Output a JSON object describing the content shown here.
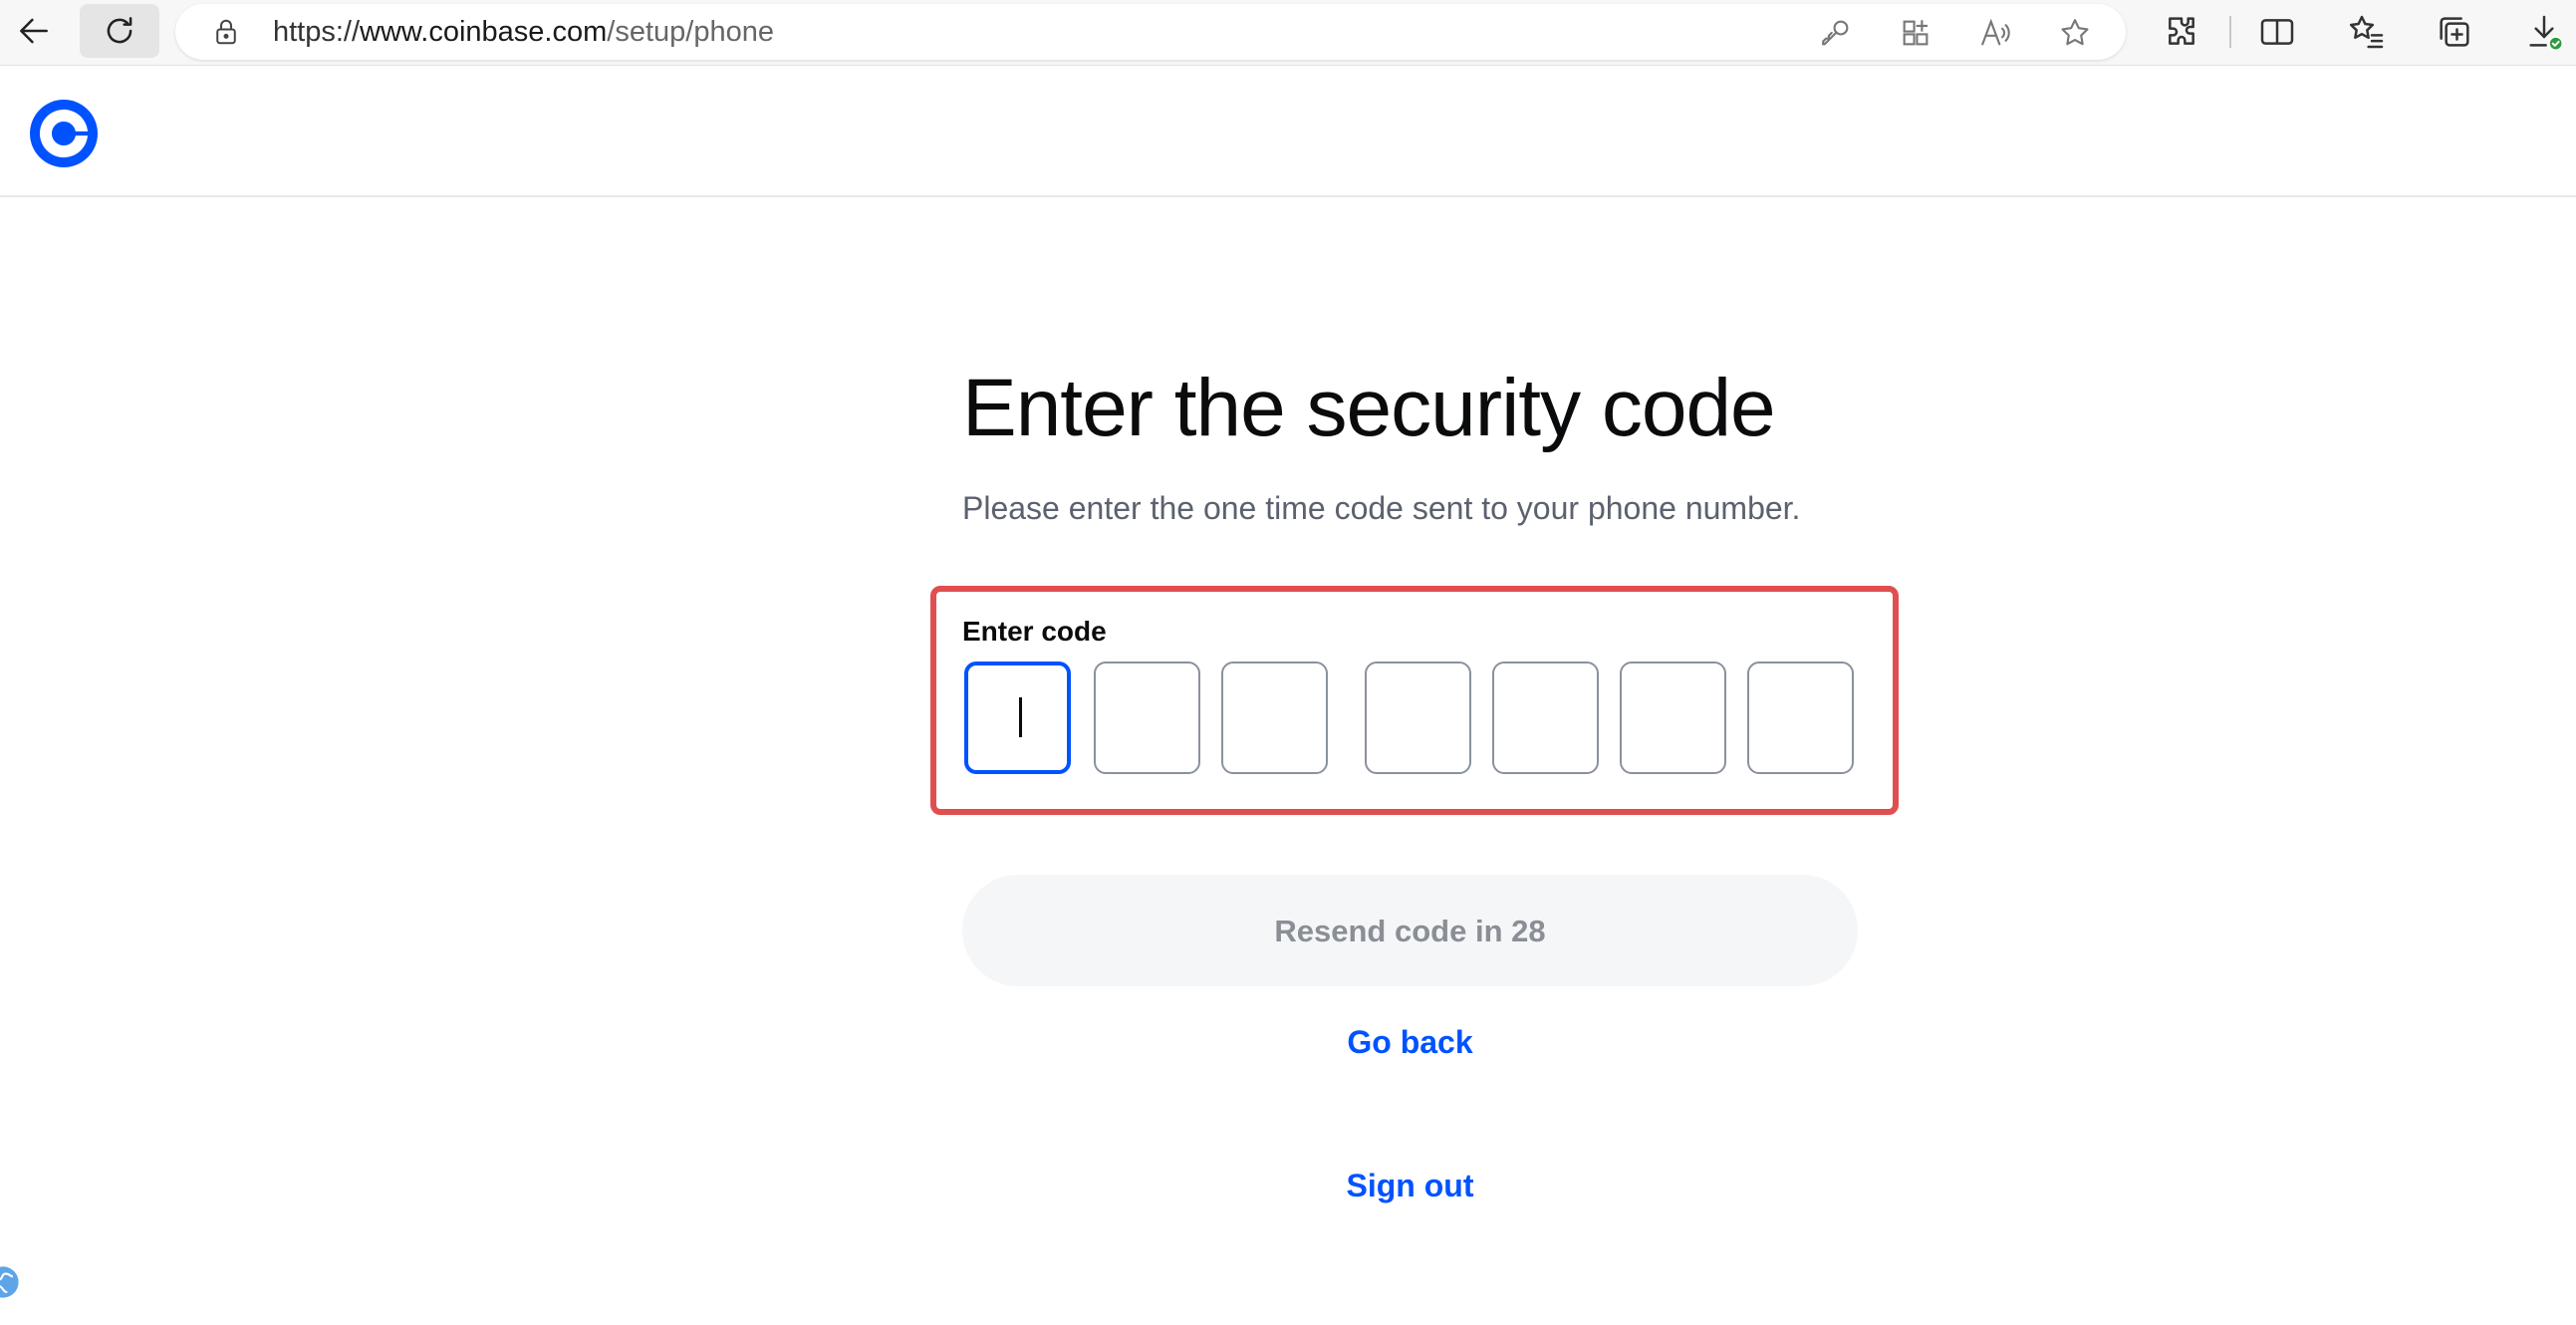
{
  "browser": {
    "url_scheme": "https://",
    "url_host": "www.coinbase.com",
    "url_path": "/setup/phone",
    "icons": {
      "back": "arrow-left-icon",
      "reload": "reload-icon",
      "lock": "lock-icon",
      "key": "key-icon",
      "apps": "apps-icon",
      "read_aloud": "read-aloud-icon",
      "favorite": "star-icon",
      "extensions": "puzzle-icon",
      "split": "split-screen-icon",
      "favorites": "favorites-list-icon",
      "collections": "collections-icon",
      "downloads": "download-icon"
    }
  },
  "site": {
    "brand_color": "#0052ff"
  },
  "main": {
    "title": "Enter the security code",
    "subtitle": "Please enter the one time code sent to your phone number.",
    "code_label": "Enter code",
    "code_digits": [
      "",
      "",
      "",
      "",
      "",
      "",
      ""
    ],
    "resend_label": "Resend code in 28",
    "go_back_label": "Go back",
    "sign_out_label": "Sign out"
  },
  "colors": {
    "highlight_border": "#e04f4f",
    "active_input": "#0052ff",
    "link": "#0052ff"
  }
}
